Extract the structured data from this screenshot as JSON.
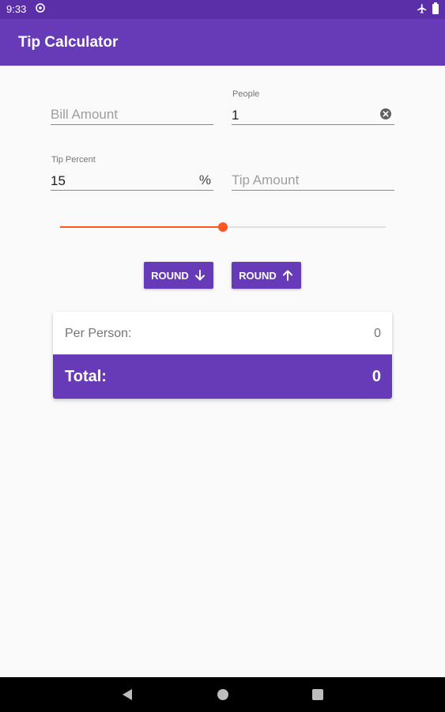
{
  "status_bar": {
    "time": "9:33"
  },
  "app_bar": {
    "title": "Tip Calculator"
  },
  "bill": {
    "placeholder": "Bill Amount"
  },
  "people": {
    "label": "People",
    "value": "1"
  },
  "tip_percent": {
    "label": "Tip Percent",
    "value": "15",
    "suffix": "%"
  },
  "tip_amount": {
    "placeholder": "Tip Amount"
  },
  "tip_slider": {
    "fraction": 0.5
  },
  "buttons": {
    "round_down": "ROUND",
    "round_up": "ROUND"
  },
  "result": {
    "per_person_label": "Per Person:",
    "per_person_value": "0",
    "total_label": "Total:",
    "total_value": "0"
  },
  "colors": {
    "primary": "#673ab7",
    "primary_dark": "#5b2fa8",
    "accent": "#ff5722",
    "background": "#fafafa"
  },
  "icons": {
    "status": [
      "notification-icon",
      "airplane-mode-icon",
      "battery-icon"
    ],
    "round_down": "arrow-down-icon",
    "round_up": "arrow-up-icon",
    "clear": "clear-icon",
    "nav": [
      "back-icon",
      "home-icon",
      "recents-icon"
    ]
  }
}
